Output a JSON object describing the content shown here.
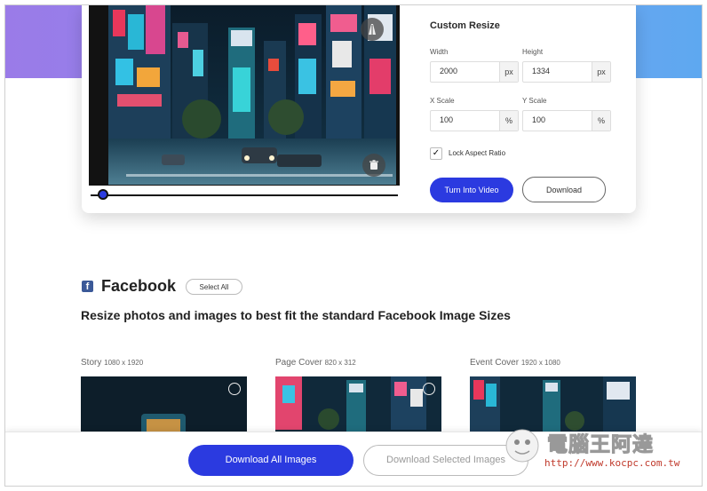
{
  "resize": {
    "title": "Custom Resize",
    "width_label": "Width",
    "width_value": "2000",
    "width_unit": "px",
    "height_label": "Height",
    "height_value": "1334",
    "height_unit": "px",
    "xscale_label": "X Scale",
    "xscale_value": "100",
    "xscale_unit": "%",
    "yscale_label": "Y Scale",
    "yscale_value": "100",
    "yscale_unit": "%",
    "lock_label": "Lock Aspect Ratio",
    "lock_checked": true,
    "turn_into_video_label": "Turn Into Video",
    "download_label": "Download"
  },
  "facebook": {
    "title": "Facebook",
    "select_all_label": "Select All",
    "subtitle": "Resize photos and images to best fit the standard Facebook Image Sizes",
    "sizes": [
      {
        "name": "Story",
        "dims": "1080 x 1920"
      },
      {
        "name": "Page Cover",
        "dims": "820 x 312"
      },
      {
        "name": "Event Cover",
        "dims": "1920 x 1080"
      }
    ]
  },
  "bottom": {
    "download_all_label": "Download All Images",
    "download_selected_label": "Download Selected Images"
  },
  "watermark": {
    "text": "電腦王阿達",
    "url": "http://www.kocpc.com.tw"
  },
  "colors": {
    "accent": "#2b3ae0",
    "facebook": "#3b5998"
  }
}
